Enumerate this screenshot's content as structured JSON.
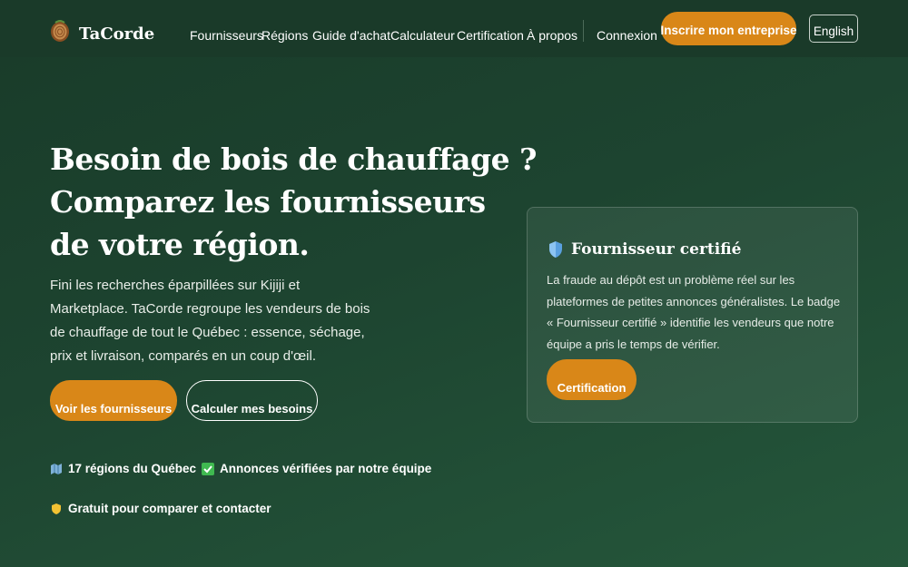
{
  "header": {
    "logo_text": "TaCorde",
    "nav": [
      "Fournisseurs",
      "Régions",
      "Guide d'achat",
      "Calculateur",
      "Certification",
      "À propos"
    ],
    "login_label": "Connexion",
    "signup_label": "Inscrire mon entreprise",
    "language_label": "English"
  },
  "hero": {
    "title_lines": [
      "Besoin de bois de chauffage ?",
      "Comparez les fournisseurs",
      "de votre région."
    ],
    "description": "Fini les recherches éparpillées sur Kijiji et Marketplace. TaCorde regroupe les vendeurs de bois de chauffage de tout le Québec : essence, séchage, prix et livraison, comparés en un coup d'œil.",
    "primary_button": "Voir les fournisseurs",
    "secondary_button": "Calculer mes besoins",
    "features": [
      {
        "icon": "map-icon",
        "text": "17 régions du Québec"
      },
      {
        "icon": "check-icon",
        "text": "Annonces vérifiées par notre équipe"
      },
      {
        "icon": "shield-icon",
        "text": "Gratuit pour comparer et contacter"
      }
    ]
  },
  "card": {
    "icon": "shield-icon",
    "title": "Fournisseur certifié",
    "text": "La fraude au dépôt est un problème réel sur les plateformes de petites annonces généralistes. Le badge « Fournisseur certifié » identifie les vendeurs que notre équipe a pris le temps de vérifier.",
    "button": "Certification"
  },
  "colors": {
    "accent": "#d98718",
    "background": "#1d4430",
    "header": "#1a3a29"
  }
}
